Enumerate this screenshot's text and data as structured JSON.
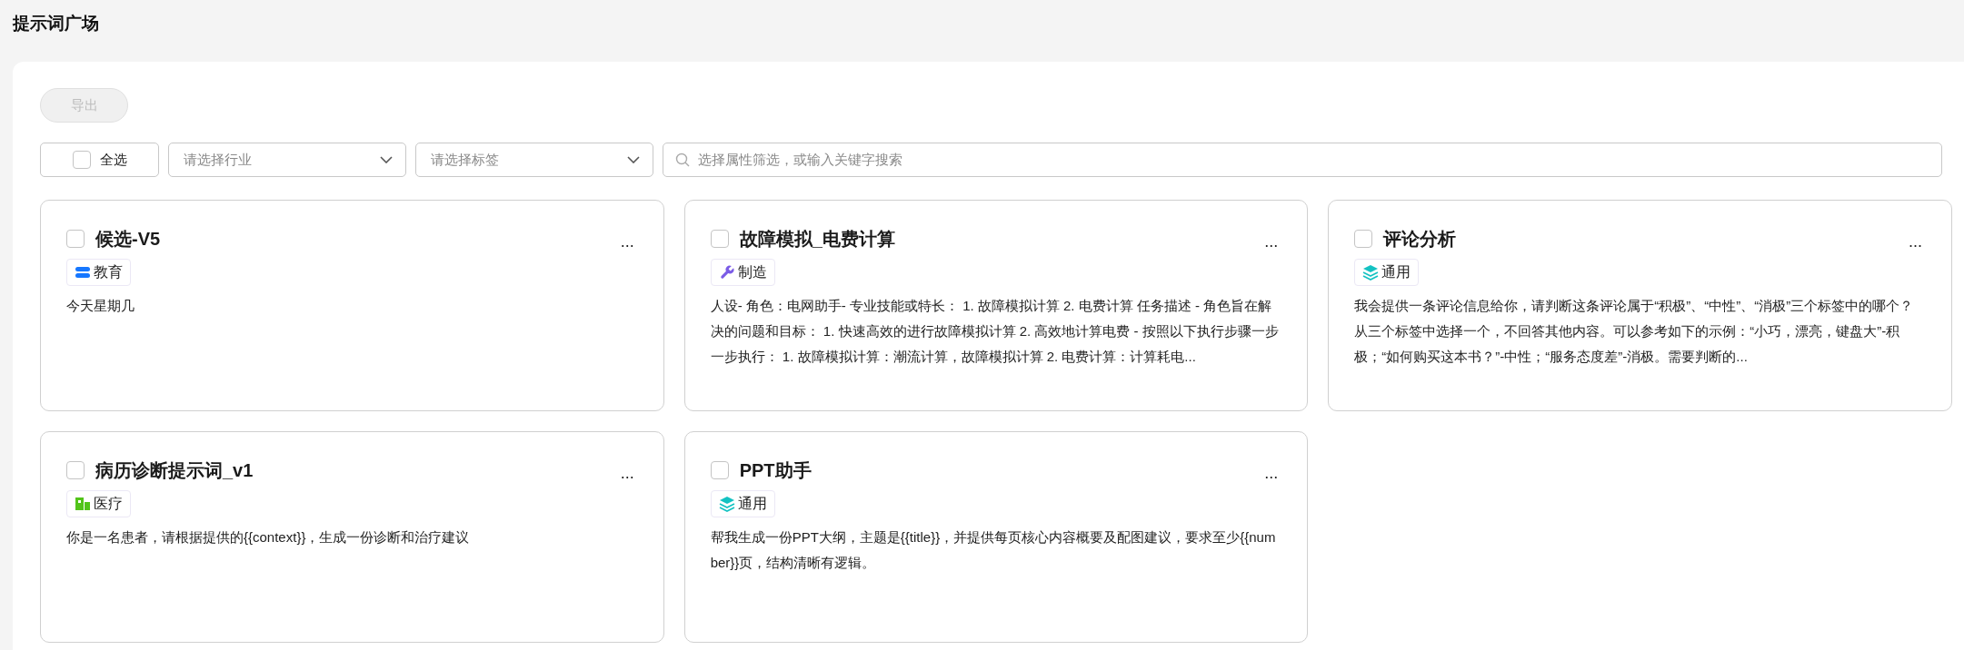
{
  "page_title": "提示词广场",
  "toolbar": {
    "export_button": {
      "label": "导出",
      "disabled": true
    }
  },
  "filters": {
    "select_all": {
      "label": "全选",
      "checked": false
    },
    "industry_select": {
      "placeholder": "请选择行业"
    },
    "tag_select": {
      "placeholder": "请选择标签"
    },
    "search": {
      "placeholder": "选择属性筛选，或输入关键字搜索"
    }
  },
  "cards": [
    {
      "title": "候选-V5",
      "checked": false,
      "more": "...",
      "tag": {
        "kind": "education",
        "label": "教育"
      },
      "description": "今天星期几"
    },
    {
      "title": "故障模拟_电费计算",
      "checked": false,
      "more": "...",
      "tag": {
        "kind": "manufacturing",
        "label": "制造"
      },
      "description": "人设- 角色：电网助手- 专业技能或特长：  1. 故障模拟计算 2. 电费计算 任务描述 - 角色旨在解决的问题和目标：  1. 快速高效的进行故障模拟计算 2. 高效地计算电费 - 按照以下执行步骤一步一步执行：  1. 故障模拟计算：潮流计算，故障模拟计算 2. 电费计算：计算耗电..."
    },
    {
      "title": "评论分析",
      "checked": false,
      "more": "...",
      "tag": {
        "kind": "general",
        "label": "通用"
      },
      "description": "我会提供一条评论信息给你，请判断这条评论属于“积极”、“中性”、“消极”三个标签中的哪个？从三个标签中选择一个，不回答其他内容。可以参考如下的示例：“小巧，漂亮，键盘大”-积极；“如何购买这本书？”-中性；“服务态度差”-消极。需要判断的..."
    },
    {
      "title": "病历诊断提示词_v1",
      "checked": false,
      "more": "...",
      "tag": {
        "kind": "medical",
        "label": "医疗"
      },
      "description": "你是一名患者，请根据提供的{{context}}，生成一份诊断和治疗建议"
    },
    {
      "title": "PPT助手",
      "checked": false,
      "more": "...",
      "tag": {
        "kind": "general",
        "label": "通用"
      },
      "description": "帮我生成一份PPT大纲，主题是{{title}}，并提供每页核心内容概要及配图建议，要求至少{{number}}页，结构清晰有逻辑。"
    }
  ]
}
